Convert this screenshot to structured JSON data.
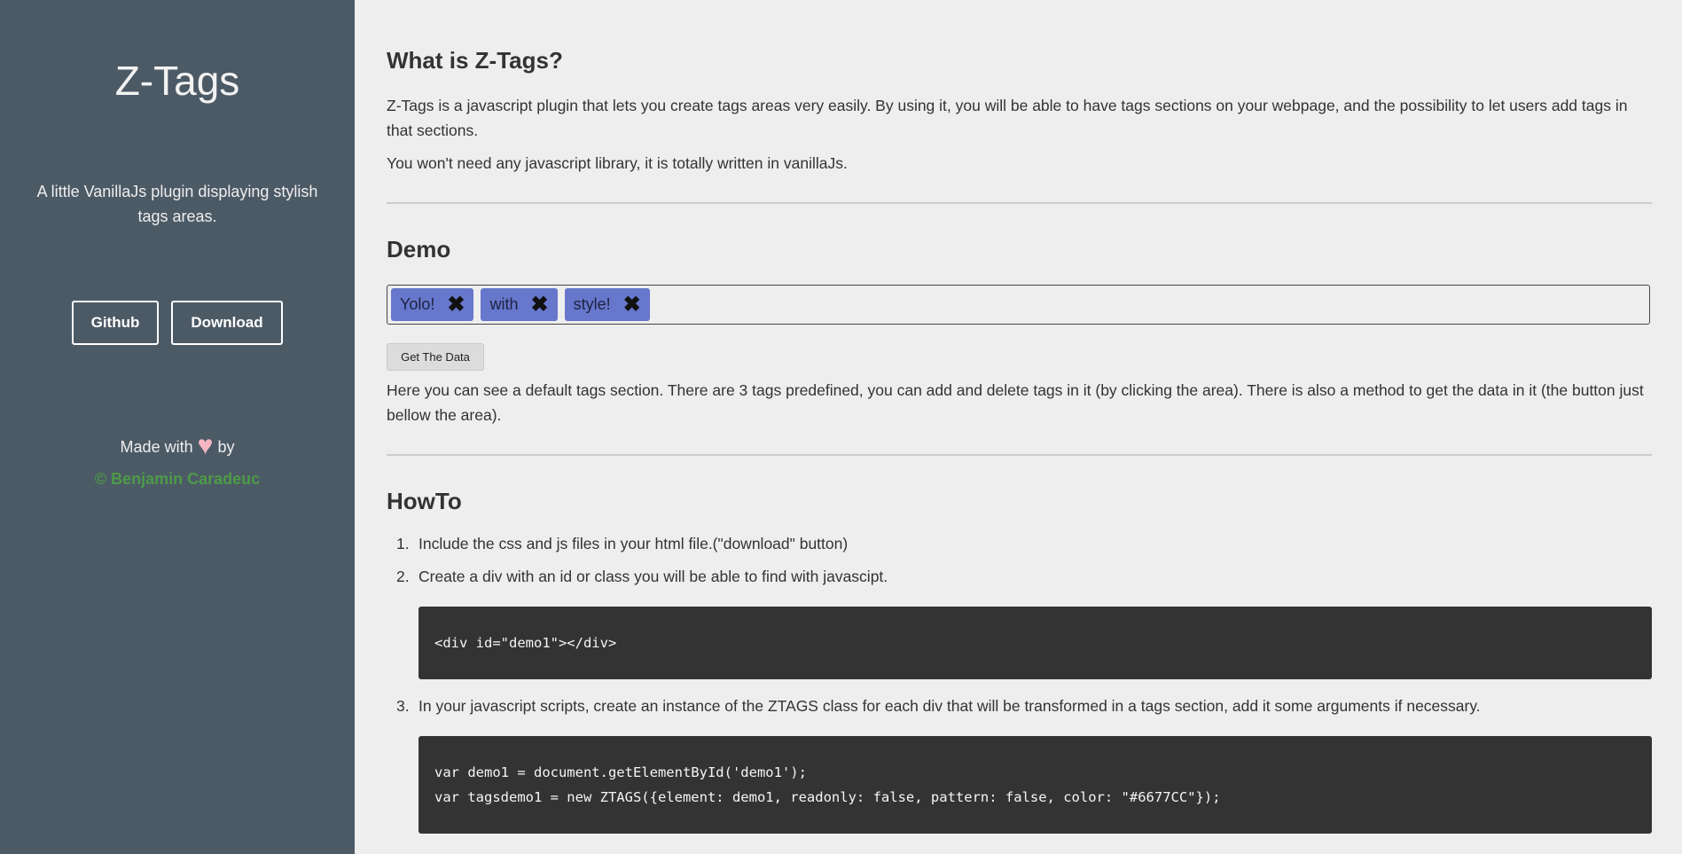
{
  "sidebar": {
    "title": "Z-Tags",
    "description": "A little VanillaJs plugin displaying stylish tags areas.",
    "buttons": {
      "github": "Github",
      "download": "Download"
    },
    "made_with_prefix": "Made with",
    "heart": "♥",
    "made_with_suffix": "by",
    "author": "© Benjamin Caradeuc",
    "colors": {
      "background": "#4c5a66",
      "author": "#4d9a48",
      "heart": "#f4b6c2"
    }
  },
  "main": {
    "what": {
      "heading": "What is Z-Tags?",
      "p1": "Z-Tags is a javascript plugin that lets you create tags areas very easily. By using it, you will be able to have tags sections on your webpage, and the possibility to let users add tags in that sections.",
      "p2": "You won't need any javascript library, it is totally written in vanillaJs."
    },
    "demo": {
      "heading": "Demo",
      "tags": [
        {
          "label": "Yolo!",
          "remove_icon": "close-icon"
        },
        {
          "label": "with",
          "remove_icon": "close-icon"
        },
        {
          "label": "style!",
          "remove_icon": "close-icon"
        }
      ],
      "tag_color": "#6677cc",
      "remove_glyph": "✖",
      "get_button": "Get The Data",
      "description": "Here you can see a default tags section. There are 3 tags predefined, you can add and delete tags in it (by clicking the area). There is also a method to get the data in it (the button just bellow the area)."
    },
    "howto": {
      "heading": "HowTo",
      "steps": [
        {
          "num": "1.",
          "text": "Include the css and js files in your html file.(\"download\" button)"
        },
        {
          "num": "2.",
          "text": "Create a div with an id or class you will be able to find with javascipt."
        },
        {
          "num": "3.",
          "text": "In your javascript scripts, create an instance of the ZTAGS class for each div that will be transformed in a tags section, add it some arguments if necessary."
        }
      ],
      "code1": [
        "<div id=\"demo1\"></div>"
      ],
      "code2": [
        "var demo1 = document.getElementById('demo1');",
        "var tagsdemo1 = new ZTAGS({element: demo1, readonly: false, pattern: false, color: \"#6677CC\"});"
      ]
    }
  }
}
